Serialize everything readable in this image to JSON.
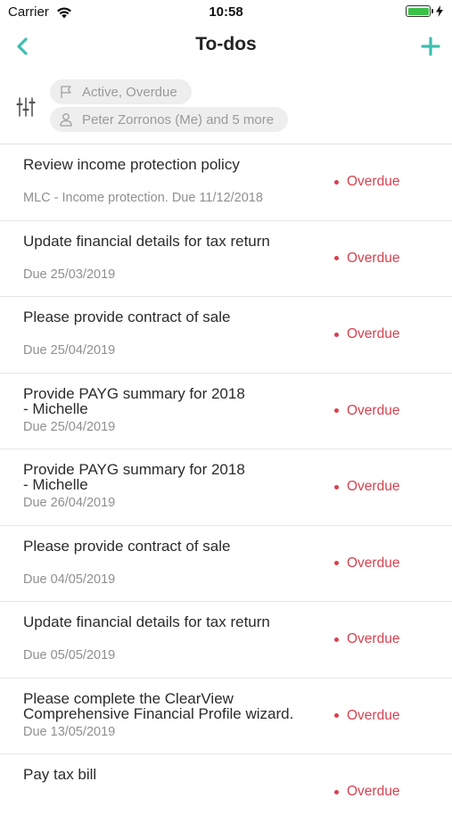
{
  "status_bar": {
    "carrier": "Carrier",
    "time": "10:58",
    "battery_level": 1.0
  },
  "nav": {
    "title": "To-dos",
    "back_icon": "chevron-left-icon",
    "add_icon": "plus-icon"
  },
  "colors": {
    "accent": "#3dbfb0",
    "overdue": "#d9404f",
    "battery": "#3ac146"
  },
  "filters": {
    "status_chip": "Active, Overdue",
    "people_chip": "Peter Zorronos (Me) and 5 more"
  },
  "todos": [
    {
      "title": "Review income protection policy",
      "subtitle": "MLC - Income protection. Due 11/12/2018",
      "status": "Overdue"
    },
    {
      "title": "Update financial details for tax return",
      "subtitle": "Due 25/03/2019",
      "status": "Overdue"
    },
    {
      "title": "Please provide contract of sale",
      "subtitle": "Due 25/04/2019",
      "status": "Overdue"
    },
    {
      "title": "Provide PAYG summary for 2018\n- Michelle",
      "subtitle": "Due 25/04/2019",
      "status": "Overdue"
    },
    {
      "title": "Provide PAYG summary for 2018\n- Michelle",
      "subtitle": "Due 26/04/2019",
      "status": "Overdue"
    },
    {
      "title": "Please provide contract of sale",
      "subtitle": "Due 04/05/2019",
      "status": "Overdue"
    },
    {
      "title": "Update financial details for tax return",
      "subtitle": "Due 05/05/2019",
      "status": "Overdue"
    },
    {
      "title": "Please complete the ClearView\nComprehensive Financial Profile wizard.",
      "subtitle": "Due 13/05/2019",
      "status": "Overdue"
    },
    {
      "title": "Pay tax bill",
      "subtitle": "",
      "status": "Overdue"
    }
  ]
}
